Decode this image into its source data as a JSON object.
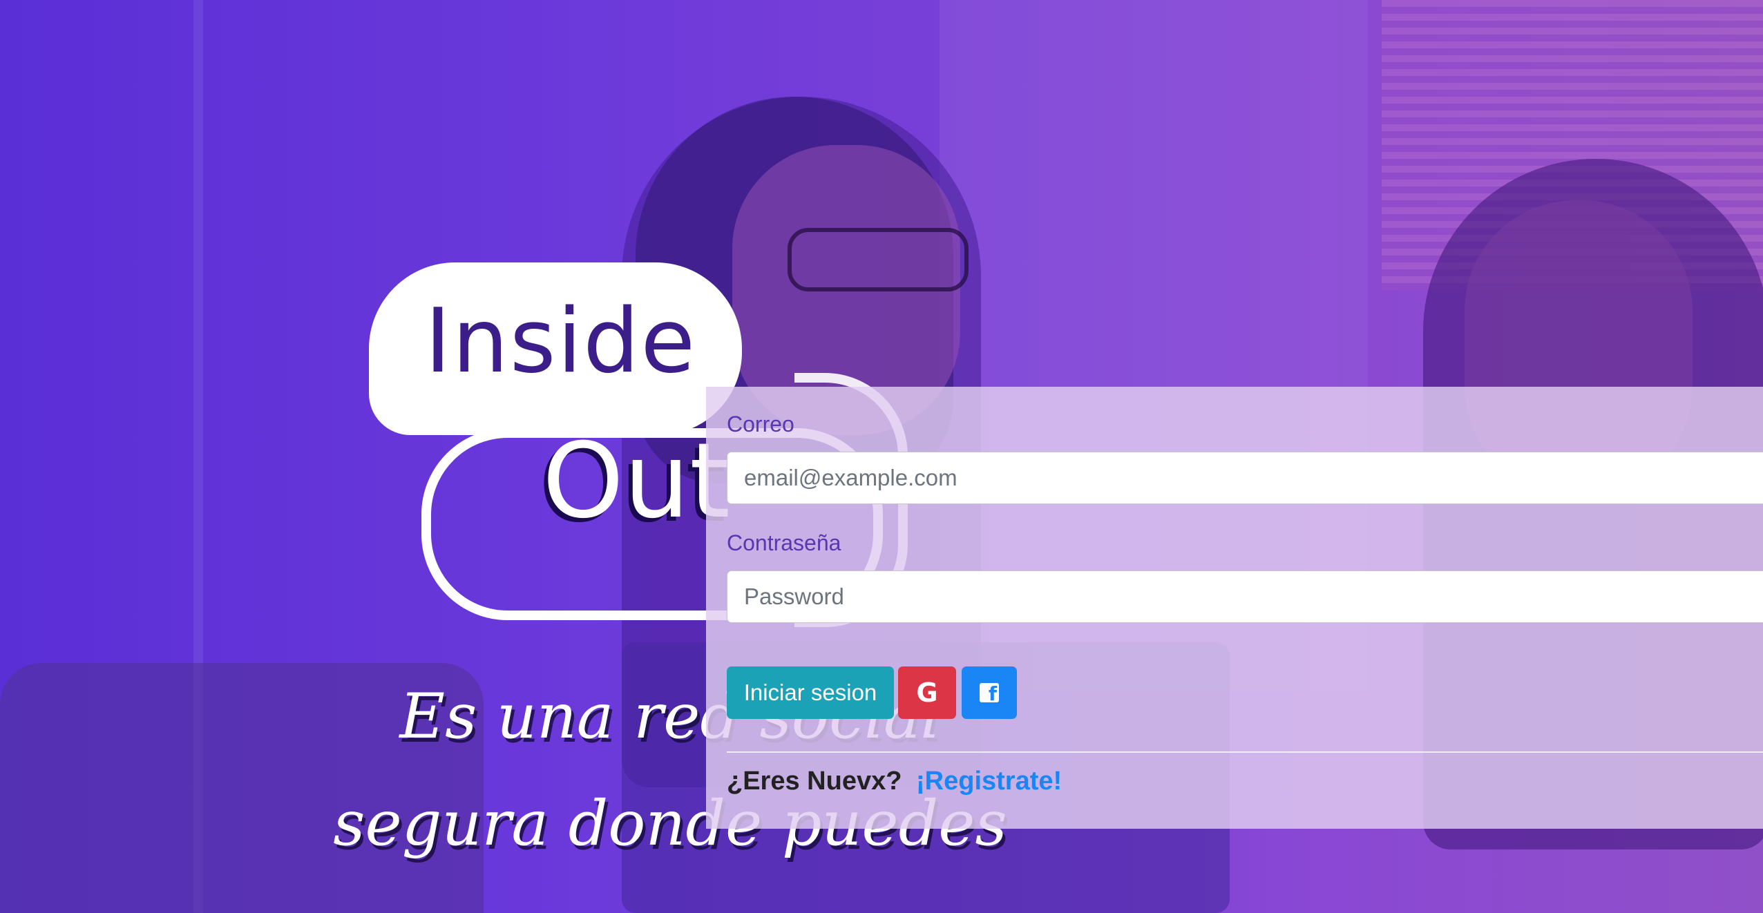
{
  "logo": {
    "top_word": "Inside",
    "bottom_word": "Out"
  },
  "tagline": {
    "lines": [
      "Es una red social",
      "segura donde puedes"
    ]
  },
  "login": {
    "email_label": "Correo",
    "email_placeholder": "email@example.com",
    "email_value": "",
    "password_label": "Contraseña",
    "password_placeholder": "Password",
    "password_value": "",
    "login_button": "Iniciar sesion",
    "google_icon": "google-icon",
    "facebook_icon": "facebook-icon",
    "signup_prompt": "¿Eres Nuevx?",
    "signup_link": "¡Registrate!"
  },
  "colors": {
    "login_button": "#1ba2b6",
    "google_button": "#dc3545",
    "facebook_button": "#1a86f5",
    "label_text": "#5a36b0",
    "link": "#1a86f5"
  }
}
